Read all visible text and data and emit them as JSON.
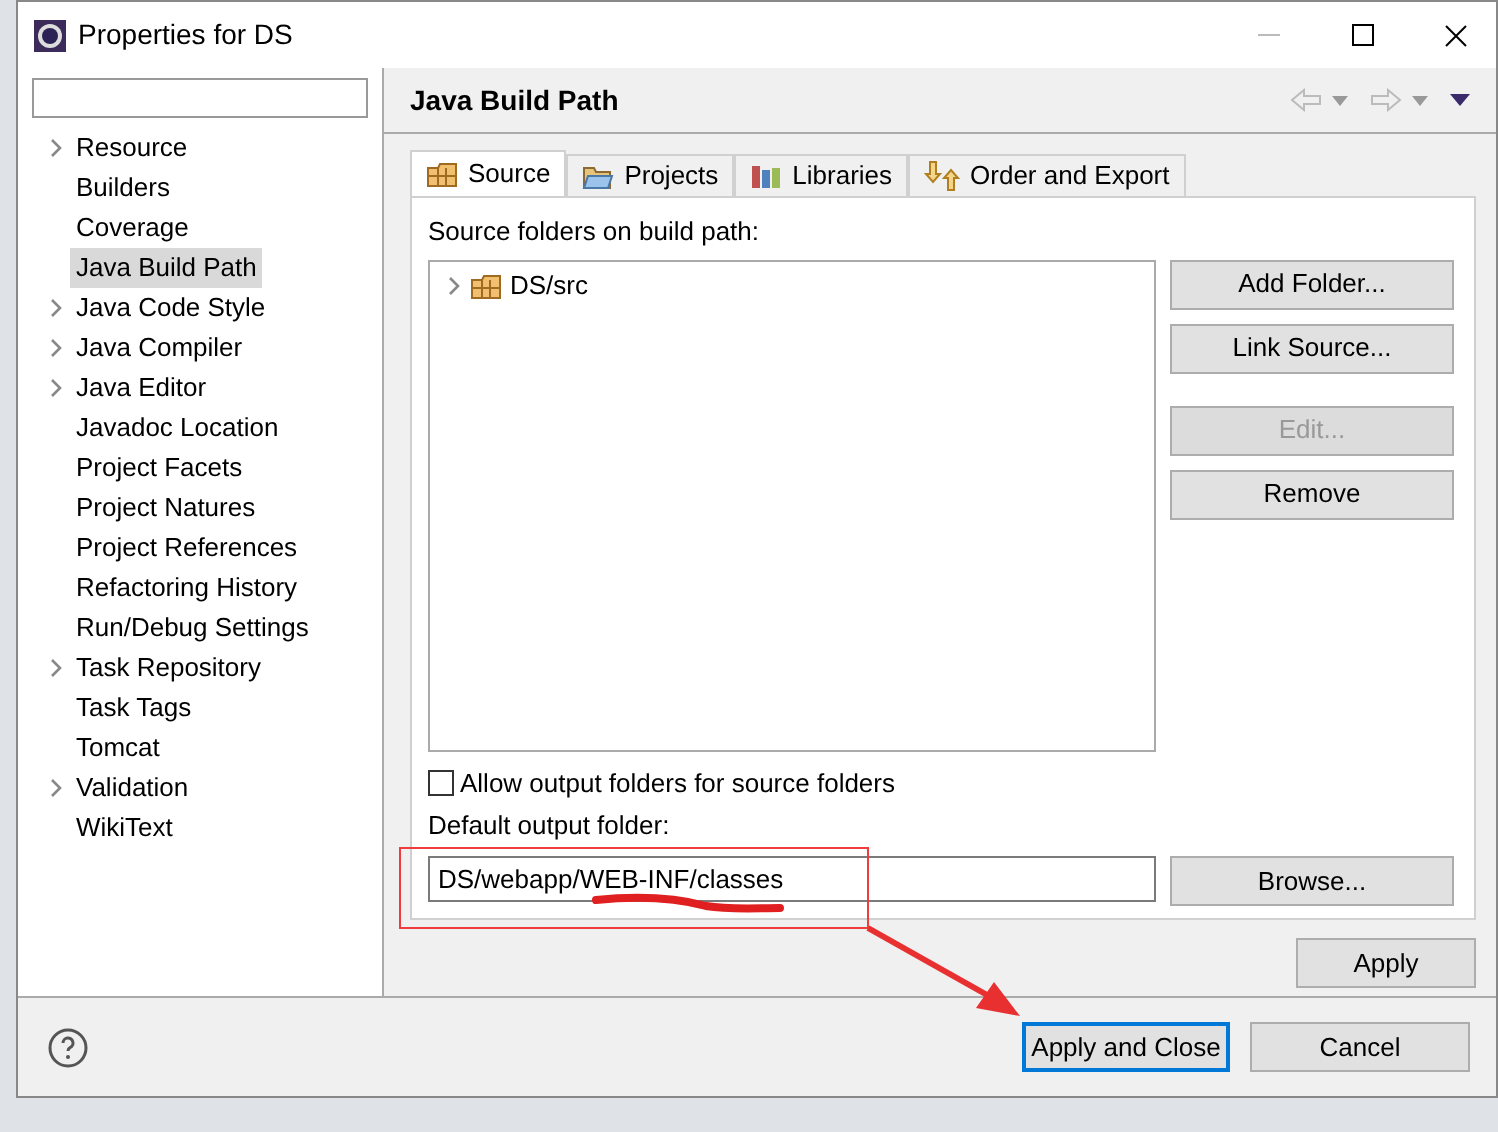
{
  "window": {
    "title": "Properties for DS"
  },
  "sidebar": {
    "items": [
      {
        "label": "Resource",
        "expandable": true,
        "selected": false
      },
      {
        "label": "Builders",
        "expandable": false,
        "selected": false
      },
      {
        "label": "Coverage",
        "expandable": false,
        "selected": false
      },
      {
        "label": "Java Build Path",
        "expandable": false,
        "selected": true
      },
      {
        "label": "Java Code Style",
        "expandable": true,
        "selected": false
      },
      {
        "label": "Java Compiler",
        "expandable": true,
        "selected": false
      },
      {
        "label": "Java Editor",
        "expandable": true,
        "selected": false
      },
      {
        "label": "Javadoc Location",
        "expandable": false,
        "selected": false
      },
      {
        "label": "Project Facets",
        "expandable": false,
        "selected": false
      },
      {
        "label": "Project Natures",
        "expandable": false,
        "selected": false
      },
      {
        "label": "Project References",
        "expandable": false,
        "selected": false
      },
      {
        "label": "Refactoring History",
        "expandable": false,
        "selected": false
      },
      {
        "label": "Run/Debug Settings",
        "expandable": false,
        "selected": false
      },
      {
        "label": "Task Repository",
        "expandable": true,
        "selected": false
      },
      {
        "label": "Task Tags",
        "expandable": false,
        "selected": false
      },
      {
        "label": "Tomcat",
        "expandable": false,
        "selected": false
      },
      {
        "label": "Validation",
        "expandable": true,
        "selected": false
      },
      {
        "label": "WikiText",
        "expandable": false,
        "selected": false
      }
    ]
  },
  "page": {
    "title": "Java Build Path"
  },
  "tabs": [
    {
      "label": "Source",
      "kind": "source",
      "selected": true
    },
    {
      "label": "Projects",
      "kind": "projects",
      "selected": false
    },
    {
      "label": "Libraries",
      "kind": "libraries",
      "selected": false
    },
    {
      "label": "Order and Export",
      "kind": "order",
      "selected": false
    }
  ],
  "source_label": "Source folders on build path:",
  "source_tree": [
    {
      "label": "DS/src",
      "expanded": false
    }
  ],
  "side_buttons": [
    {
      "label": "Add Folder...",
      "disabled": false
    },
    {
      "label": "Link Source...",
      "disabled": false
    },
    {
      "label": "Edit...",
      "disabled": true
    },
    {
      "label": "Remove",
      "disabled": false
    }
  ],
  "allow_output": {
    "label": "Allow output folders for source folders",
    "checked": false
  },
  "output": {
    "label": "Default output folder:",
    "value": "DS/webapp/WEB-INF/classes",
    "browse": "Browse..."
  },
  "apply": "Apply",
  "footer": {
    "primary": "Apply and Close",
    "cancel": "Cancel"
  }
}
